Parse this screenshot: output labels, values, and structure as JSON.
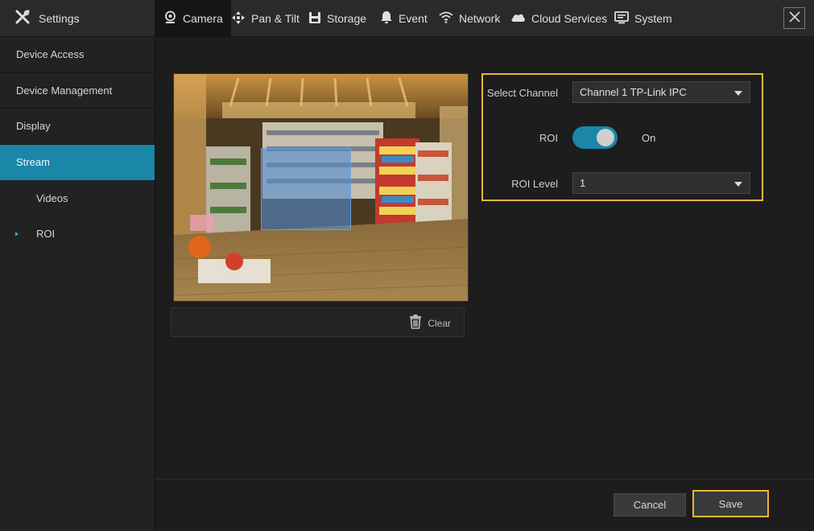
{
  "sidebar": {
    "title": "Settings",
    "title_icon": "tools-icon",
    "items": [
      {
        "label": "Device Access"
      },
      {
        "label": "Device Management"
      },
      {
        "label": "Display"
      },
      {
        "label": "Stream",
        "active": true
      }
    ],
    "subitems": [
      {
        "label": "Videos"
      },
      {
        "label": "ROI",
        "current": true
      }
    ]
  },
  "topnav": {
    "tabs": [
      {
        "label": "Camera",
        "icon": "camera-icon",
        "active": true
      },
      {
        "label": "Pan & Tilt",
        "icon": "pan-tilt-icon"
      },
      {
        "label": "Storage",
        "icon": "storage-icon"
      },
      {
        "label": "Event",
        "icon": "bell-icon"
      },
      {
        "label": "Network",
        "icon": "wifi-icon"
      },
      {
        "label": "Cloud Services",
        "icon": "cloud-icon"
      },
      {
        "label": "System",
        "icon": "monitor-icon"
      }
    ],
    "close_icon": "close-icon"
  },
  "main": {
    "clear_label": "Clear",
    "select_channel_label": "Select Channel",
    "channel_value": "Channel 1 TP-Link IPC",
    "roi_label": "ROI",
    "roi_state": "On",
    "roi_level_label": "ROI Level",
    "roi_level_value": "1"
  },
  "footer": {
    "cancel_label": "Cancel",
    "save_label": "Save"
  },
  "colors": {
    "accent": "#1a87a8",
    "highlight": "#e8b736",
    "background": "#1d1d1d"
  }
}
